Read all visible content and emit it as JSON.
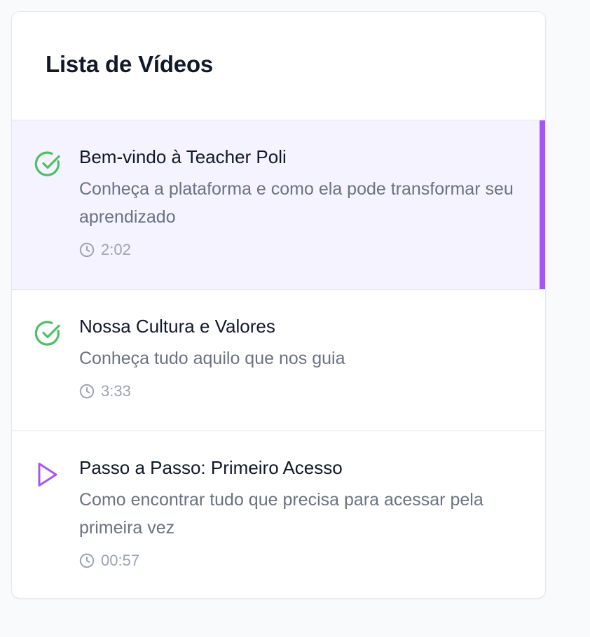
{
  "panel": {
    "title": "Lista de Vídeos"
  },
  "colors": {
    "accent": "#a855f7",
    "completed": "#4fbf67",
    "active_bg": "#f5f3ff"
  },
  "videos": [
    {
      "title": "Bem-vindo à Teacher Poli",
      "description": "Conheça a plataforma e como ela pode transformar seu aprendizado",
      "duration": "2:02",
      "status_icon": "check-circle-icon",
      "active": true
    },
    {
      "title": "Nossa Cultura e Valores",
      "description": "Conheça tudo aquilo que nos guia",
      "duration": "3:33",
      "status_icon": "check-circle-icon",
      "active": false
    },
    {
      "title": "Passo a Passo: Primeiro Acesso",
      "description": "Como encontrar tudo que precisa para acessar pela primeira vez",
      "duration": "00:57",
      "status_icon": "play-icon",
      "active": false
    }
  ]
}
